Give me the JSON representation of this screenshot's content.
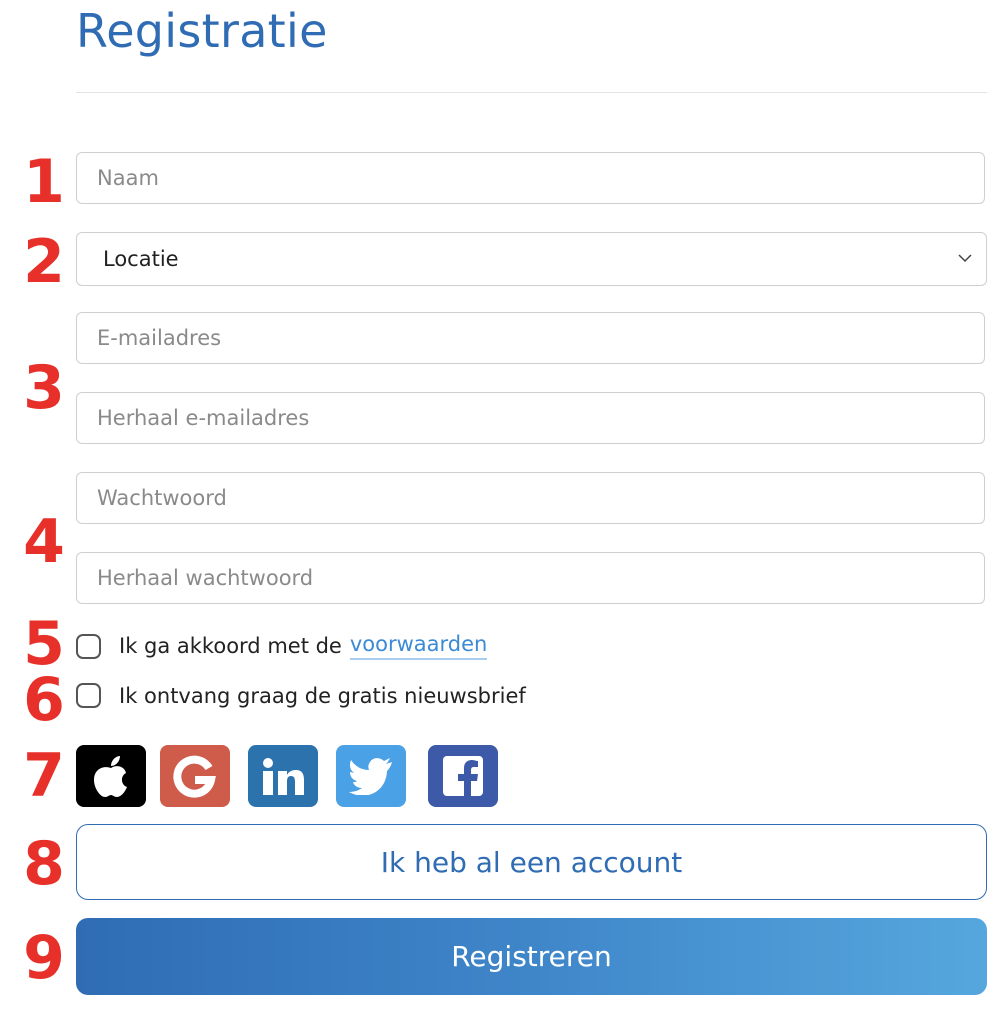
{
  "page": {
    "title": "Registratie"
  },
  "step_numbers": [
    "1",
    "2",
    "3",
    "4",
    "5",
    "6",
    "7",
    "8",
    "9"
  ],
  "form": {
    "name_placeholder": "Naam",
    "location_value": "Locatie",
    "email_placeholder": "E-mailadres",
    "email_repeat_placeholder": "Herhaal e-mailadres",
    "password_placeholder": "Wachtwoord",
    "password_repeat_placeholder": "Herhaal wachtwoord",
    "terms_text": "Ik ga akkoord met de",
    "terms_link": "voorwaarden",
    "newsletter_text": "Ik ontvang graag de gratis nieuwsbrief",
    "terms_checked": false,
    "newsletter_checked": false
  },
  "social": [
    {
      "name": "apple-icon",
      "color": "#000000"
    },
    {
      "name": "google-icon",
      "color": "#cf5b4b"
    },
    {
      "name": "linkedin-icon",
      "color": "#2c73ad"
    },
    {
      "name": "twitter-icon",
      "color": "#4aa1e6"
    },
    {
      "name": "facebook-icon",
      "color": "#3d5aa8"
    }
  ],
  "buttons": {
    "have_account": "Ik heb al een account",
    "register": "Registreren"
  },
  "colors": {
    "accent": "#2f6cb3",
    "marker": "#e8302a",
    "link": "#3a8ad6"
  }
}
